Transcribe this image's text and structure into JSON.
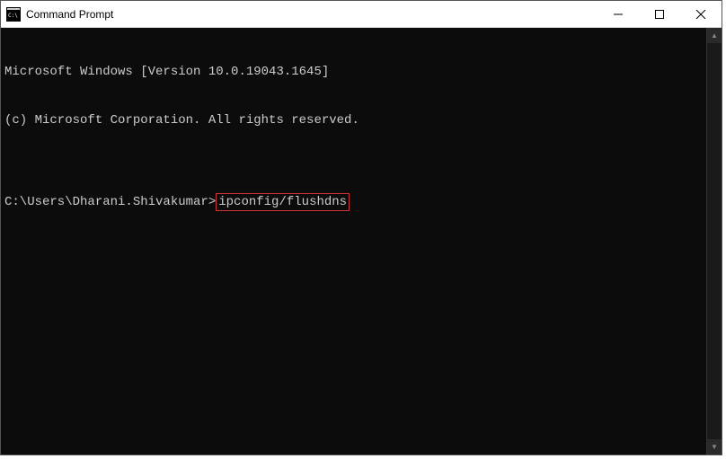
{
  "window": {
    "title": "Command Prompt"
  },
  "terminal": {
    "line1": "Microsoft Windows [Version 10.0.19043.1645]",
    "line2": "(c) Microsoft Corporation. All rights reserved.",
    "blank": "",
    "prompt": "C:\\Users\\Dharani.Shivakumar>",
    "command": "ipconfig/flushdns"
  },
  "controls": {
    "minimize": "—",
    "maximize": "☐",
    "close": "✕"
  },
  "scroll": {
    "up": "▲",
    "down": "▼"
  }
}
